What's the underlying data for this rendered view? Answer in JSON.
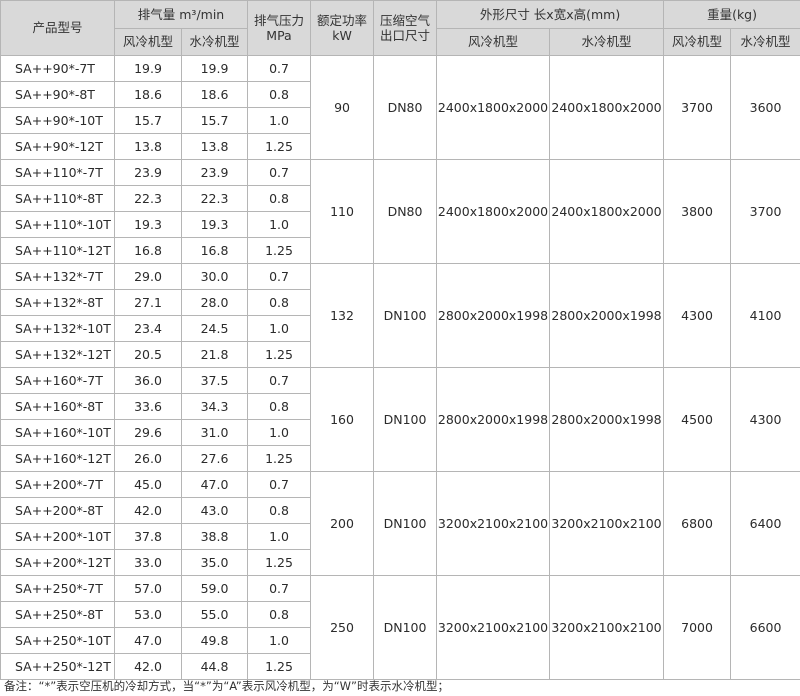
{
  "header": {
    "model": "产品型号",
    "air_delivery": "排气量 m³/min",
    "air_cooled": "风冷机型",
    "water_cooled": "水冷机型",
    "pressure_line1": "排气压力",
    "pressure_line2": "MPa",
    "power_line1": "额定功率",
    "power_line2": "kW",
    "outlet_line1": "压缩空气",
    "outlet_line2": "出口尺寸",
    "dimensions": "外形尺寸  长x宽x高(mm)",
    "weight": "重量(kg)"
  },
  "groups": [
    {
      "power": "90",
      "outlet": "DN80",
      "dim_air": "2400x1800x2000",
      "dim_water": "2400x1800x2000",
      "weight_air": "3700",
      "weight_water": "3600",
      "rows": [
        {
          "model": "SA++90*-7T",
          "air": "19.9",
          "water": "19.9",
          "pressure": "0.7"
        },
        {
          "model": "SA++90*-8T",
          "air": "18.6",
          "water": "18.6",
          "pressure": "0.8"
        },
        {
          "model": "SA++90*-10T",
          "air": "15.7",
          "water": "15.7",
          "pressure": "1.0"
        },
        {
          "model": "SA++90*-12T",
          "air": "13.8",
          "water": "13.8",
          "pressure": "1.25"
        }
      ]
    },
    {
      "power": "110",
      "outlet": "DN80",
      "dim_air": "2400x1800x2000",
      "dim_water": "2400x1800x2000",
      "weight_air": "3800",
      "weight_water": "3700",
      "rows": [
        {
          "model": "SA++110*-7T",
          "air": "23.9",
          "water": "23.9",
          "pressure": "0.7"
        },
        {
          "model": "SA++110*-8T",
          "air": "22.3",
          "water": "22.3",
          "pressure": "0.8"
        },
        {
          "model": "SA++110*-10T",
          "air": "19.3",
          "water": "19.3",
          "pressure": "1.0"
        },
        {
          "model": "SA++110*-12T",
          "air": "16.8",
          "water": "16.8",
          "pressure": "1.25"
        }
      ]
    },
    {
      "power": "132",
      "outlet": "DN100",
      "dim_air": "2800x2000x1998",
      "dim_water": "2800x2000x1998",
      "weight_air": "4300",
      "weight_water": "4100",
      "rows": [
        {
          "model": "SA++132*-7T",
          "air": "29.0",
          "water": "30.0",
          "pressure": "0.7"
        },
        {
          "model": "SA++132*-8T",
          "air": "27.1",
          "water": "28.0",
          "pressure": "0.8"
        },
        {
          "model": "SA++132*-10T",
          "air": "23.4",
          "water": "24.5",
          "pressure": "1.0"
        },
        {
          "model": "SA++132*-12T",
          "air": "20.5",
          "water": "21.8",
          "pressure": "1.25"
        }
      ]
    },
    {
      "power": "160",
      "outlet": "DN100",
      "dim_air": "2800x2000x1998",
      "dim_water": "2800x2000x1998",
      "weight_air": "4500",
      "weight_water": "4300",
      "rows": [
        {
          "model": "SA++160*-7T",
          "air": "36.0",
          "water": "37.5",
          "pressure": "0.7"
        },
        {
          "model": "SA++160*-8T",
          "air": "33.6",
          "water": "34.3",
          "pressure": "0.8"
        },
        {
          "model": "SA++160*-10T",
          "air": "29.6",
          "water": "31.0",
          "pressure": "1.0"
        },
        {
          "model": "SA++160*-12T",
          "air": "26.0",
          "water": "27.6",
          "pressure": "1.25"
        }
      ]
    },
    {
      "power": "200",
      "outlet": "DN100",
      "dim_air": "3200x2100x2100",
      "dim_water": "3200x2100x2100",
      "weight_air": "6800",
      "weight_water": "6400",
      "rows": [
        {
          "model": "SA++200*-7T",
          "air": "45.0",
          "water": "47.0",
          "pressure": "0.7"
        },
        {
          "model": "SA++200*-8T",
          "air": "42.0",
          "water": "43.0",
          "pressure": "0.8"
        },
        {
          "model": "SA++200*-10T",
          "air": "37.8",
          "water": "38.8",
          "pressure": "1.0"
        },
        {
          "model": "SA++200*-12T",
          "air": "33.0",
          "water": "35.0",
          "pressure": "1.25"
        }
      ]
    },
    {
      "power": "250",
      "outlet": "DN100",
      "dim_air": "3200x2100x2100",
      "dim_water": "3200x2100x2100",
      "weight_air": "7000",
      "weight_water": "6600",
      "rows": [
        {
          "model": "SA++250*-7T",
          "air": "57.0",
          "water": "59.0",
          "pressure": "0.7"
        },
        {
          "model": "SA++250*-8T",
          "air": "53.0",
          "water": "55.0",
          "pressure": "0.8"
        },
        {
          "model": "SA++250*-10T",
          "air": "47.0",
          "water": "49.8",
          "pressure": "1.0"
        },
        {
          "model": "SA++250*-12T",
          "air": "42.0",
          "water": "44.8",
          "pressure": "1.25"
        }
      ]
    }
  ],
  "note": "备注：“*”表示空压机的冷却方式，当“*”为“A”表示风冷机型，为“W”时表示水冷机型；"
}
